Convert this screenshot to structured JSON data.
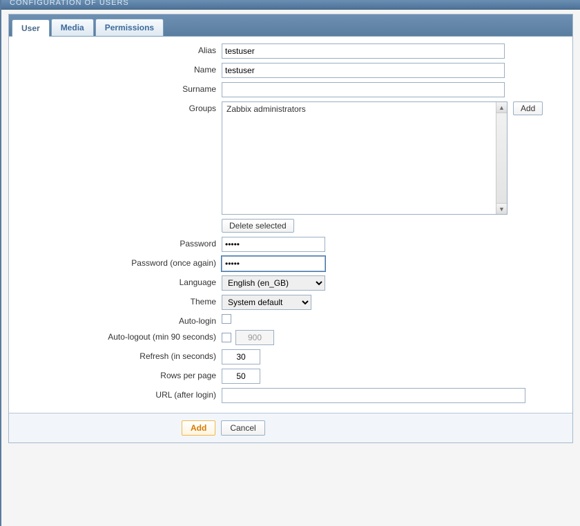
{
  "header": {
    "title": "CONFIGURATION OF USERS"
  },
  "tabs": {
    "user": "User",
    "media": "Media",
    "permissions": "Permissions"
  },
  "labels": {
    "alias": "Alias",
    "name": "Name",
    "surname": "Surname",
    "groups": "Groups",
    "delete_selected": "Delete selected",
    "password": "Password",
    "password_again": "Password (once again)",
    "language": "Language",
    "theme": "Theme",
    "auto_login": "Auto-login",
    "auto_logout": "Auto-logout (min 90 seconds)",
    "refresh": "Refresh (in seconds)",
    "rows_per_page": "Rows per page",
    "url_after_login": "URL (after login)",
    "add_btn": "Add"
  },
  "values": {
    "alias": "testuser",
    "name": "testuser",
    "surname": "",
    "group_item": "Zabbix administrators",
    "password": "•••••",
    "password_again": "•••••",
    "language": "English (en_GB)",
    "theme": "System default",
    "auto_logout_seconds": "900",
    "refresh": "30",
    "rows_per_page": "50",
    "url": ""
  },
  "footer": {
    "add": "Add",
    "cancel": "Cancel"
  }
}
